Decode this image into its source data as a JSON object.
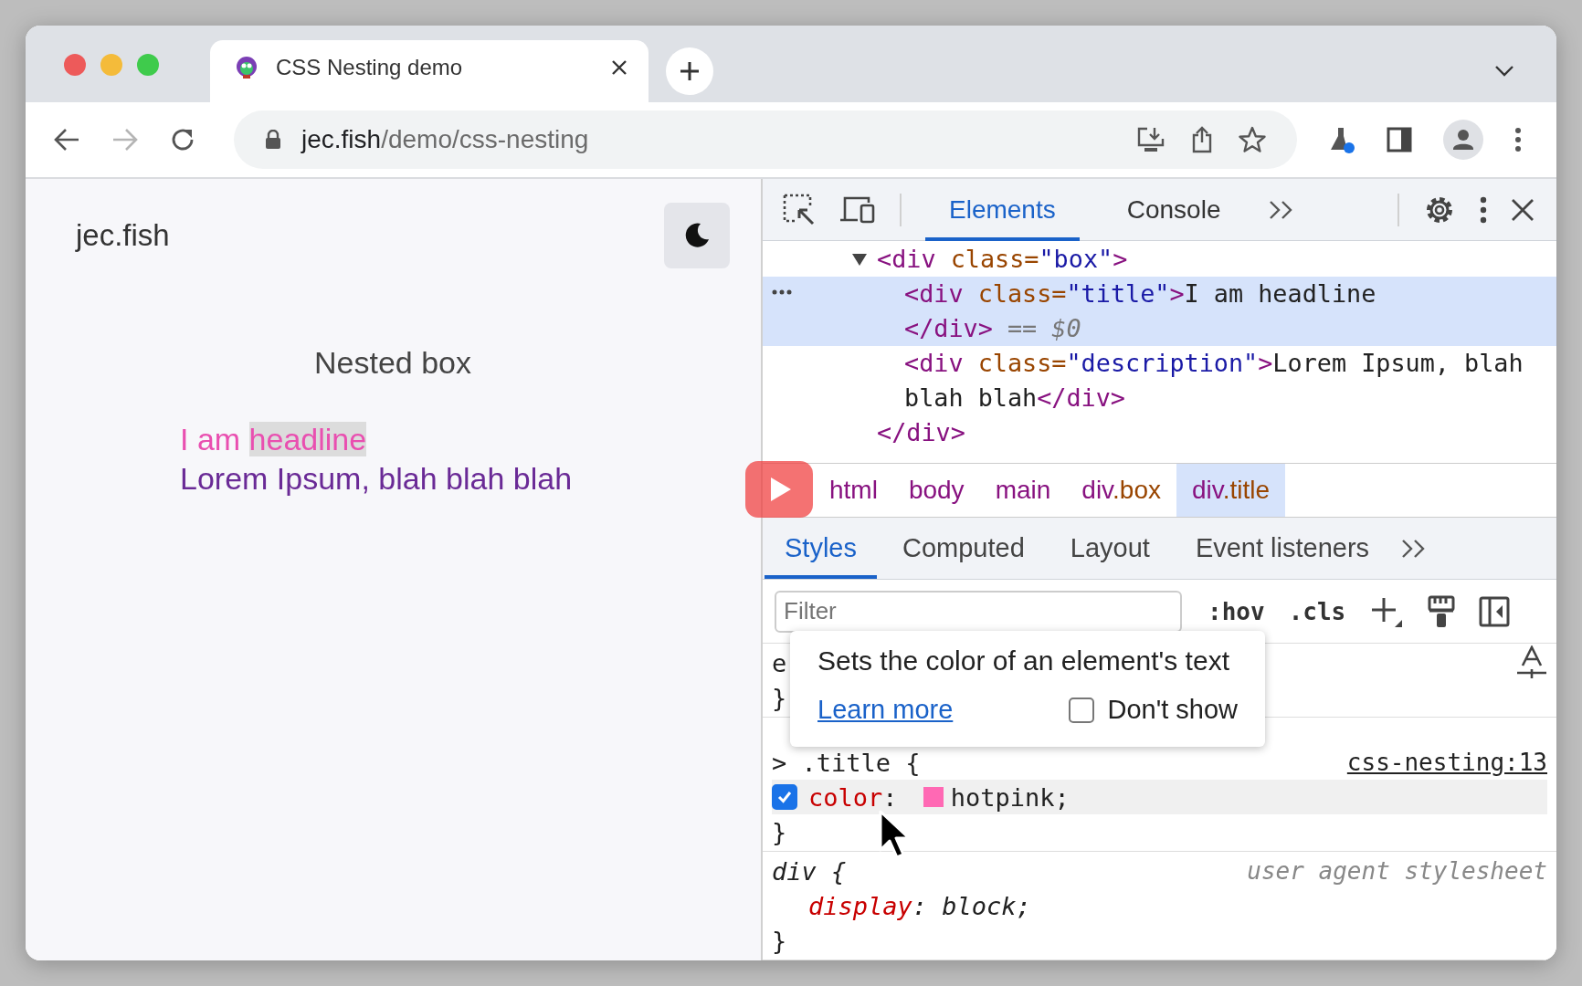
{
  "browser": {
    "tabs": [
      {
        "title": "CSS Nesting demo",
        "selected": true
      }
    ],
    "address": {
      "domain": "jec.fish",
      "path": "/demo/css-nesting"
    },
    "forward_disabled": true
  },
  "page": {
    "site_name": "jec.fish",
    "heading": "Nested box",
    "headline": [
      {
        "text": "I am ",
        "highlighted": false
      },
      {
        "text": "headline",
        "highlighted": true
      }
    ],
    "description": "Lorem Ipsum, blah blah blah"
  },
  "devtools": {
    "tabs": [
      {
        "label": "Elements",
        "selected": true
      },
      {
        "label": "Console",
        "selected": false
      }
    ],
    "dom_tree": [
      {
        "expanded": true,
        "selected": false,
        "open": [
          {
            "kind": "tag",
            "text": "<div "
          },
          {
            "kind": "attr",
            "text": "class="
          },
          {
            "kind": "value",
            "text": "\"box\""
          },
          {
            "kind": "tag",
            "text": ">"
          }
        ],
        "close": [
          {
            "kind": "tag",
            "text": "</div>"
          }
        ],
        "children": [
          {
            "selected": true,
            "open": [
              {
                "kind": "tag",
                "text": "<div "
              },
              {
                "kind": "attr",
                "text": "class="
              },
              {
                "kind": "value",
                "text": "\"title\""
              },
              {
                "kind": "tag",
                "text": ">"
              },
              {
                "kind": "text",
                "text": "I am headline"
              }
            ],
            "close": [
              {
                "kind": "tag",
                "text": "</div> "
              },
              {
                "kind": "eq",
                "text": "== "
              },
              {
                "kind": "ref",
                "text": "$0"
              }
            ]
          },
          {
            "selected": false,
            "open": [
              {
                "kind": "tag",
                "text": "<div "
              },
              {
                "kind": "attr",
                "text": "class="
              },
              {
                "kind": "value",
                "text": "\"description\""
              },
              {
                "kind": "tag",
                "text": ">"
              },
              {
                "kind": "text",
                "text": "Lorem Ipsum, blah blah blah"
              },
              {
                "kind": "tag",
                "text": "</div>"
              }
            ]
          }
        ]
      }
    ],
    "breadcrumbs": [
      {
        "tag": "html",
        "selected": false
      },
      {
        "tag": "body",
        "selected": false
      },
      {
        "tag": "main",
        "selected": false
      },
      {
        "tag": "div",
        "class": ".box",
        "selected": false
      },
      {
        "tag": "div",
        "class": ".title",
        "selected": true
      }
    ],
    "style_tabs": [
      {
        "label": "Styles",
        "selected": true
      },
      {
        "label": "Computed",
        "selected": false
      },
      {
        "label": "Layout",
        "selected": false
      },
      {
        "label": "Event listeners",
        "selected": false
      }
    ],
    "filter": {
      "placeholder": "Filter"
    },
    "style_actions": [
      ":hov",
      ".cls"
    ],
    "rules": [
      {
        "kind": "author",
        "selector": "e",
        "closing": "}"
      },
      {
        "kind": "nested",
        "selector": "> .title {",
        "source": "css-nesting:13",
        "closing": "}",
        "declarations": [
          {
            "property": "color",
            "colon": ": ",
            "color": "#ff69b4",
            "value": "hotpink;",
            "checked": true,
            "hovered": true
          }
        ]
      },
      {
        "kind": "user-agent",
        "selector": "div {",
        "source": "user agent stylesheet",
        "closing": "}",
        "declarations": [
          {
            "property": "display",
            "colon": ": ",
            "value": "block;"
          }
        ]
      }
    ],
    "tooltip": {
      "text": "Sets the color of an element's text",
      "link": "Learn more",
      "checkbox": {
        "label": "Don't show",
        "checked": false
      }
    }
  }
}
